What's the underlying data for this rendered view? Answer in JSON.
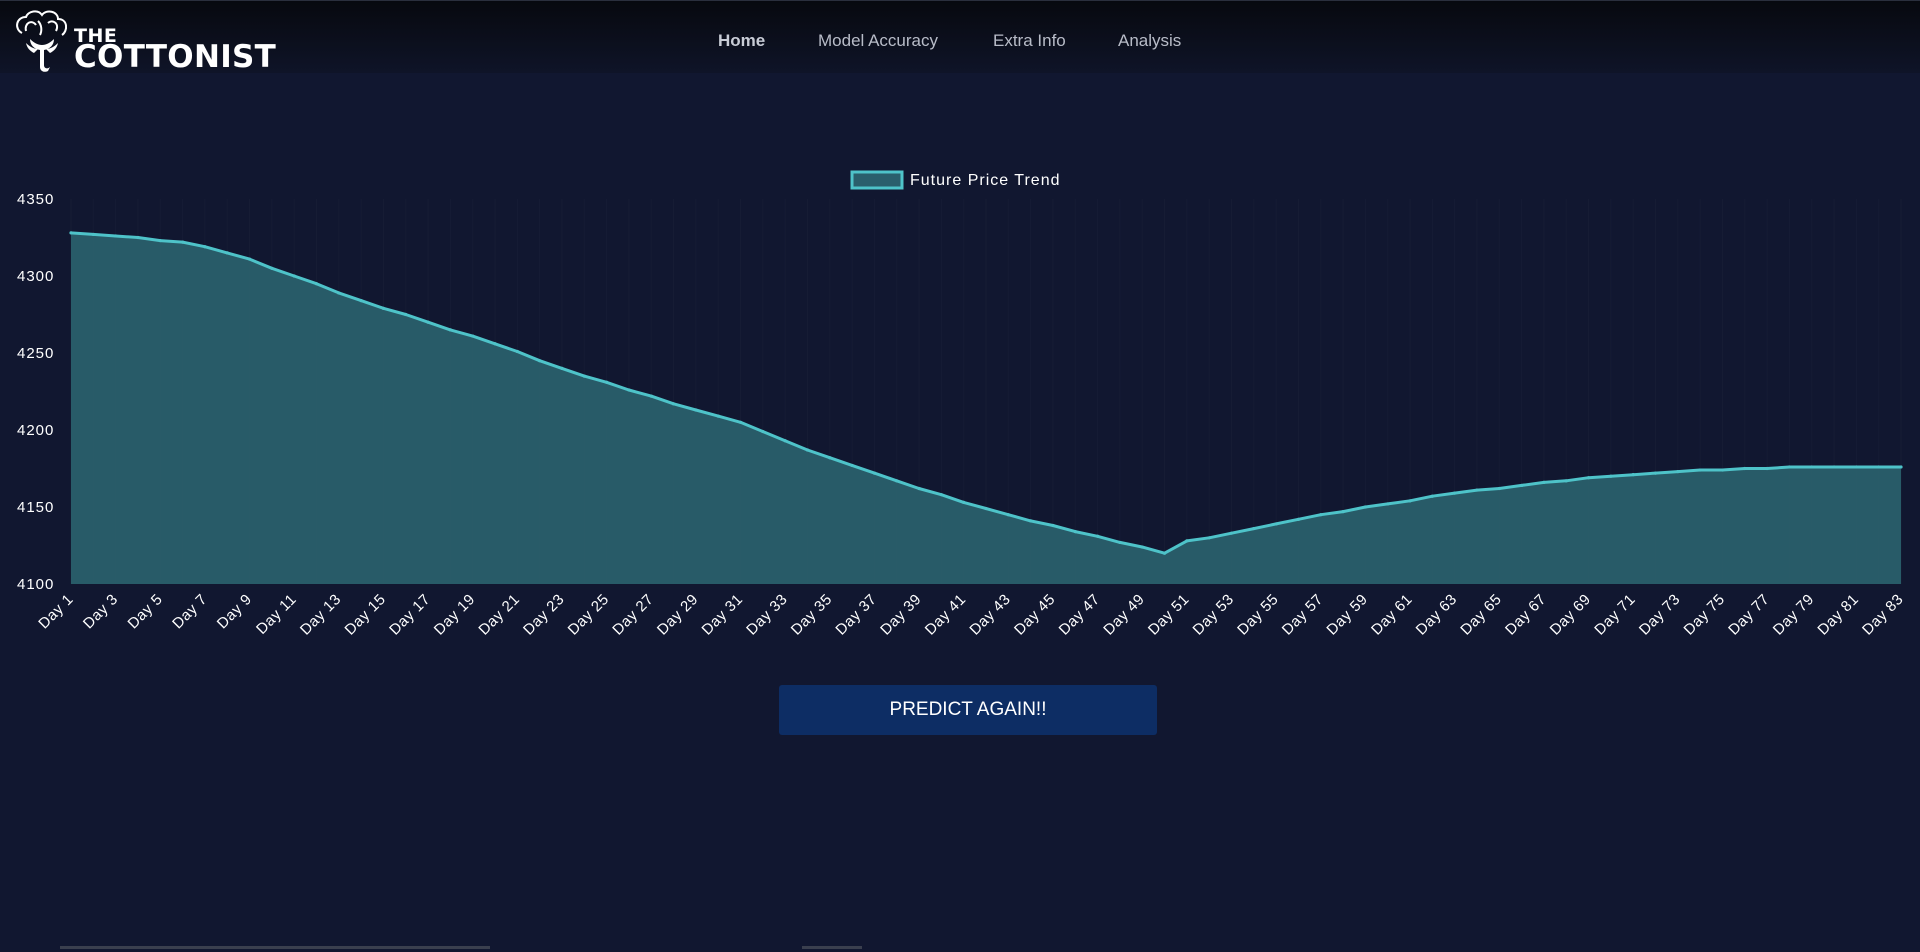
{
  "brand": {
    "line1": "THE",
    "line2": "COTTONIST",
    "icon": "cotton-plant-icon"
  },
  "nav": {
    "items": [
      {
        "label": "Home",
        "active": true
      },
      {
        "label": "Model Accuracy",
        "active": false
      },
      {
        "label": "Extra Info",
        "active": false
      },
      {
        "label": "Analysis",
        "active": false
      }
    ]
  },
  "actions": {
    "predict_label": "PREDICT AGAIN!!"
  },
  "colors": {
    "background": "#111730",
    "line": "#4ec3c9",
    "fill": "#2a5f6c",
    "button": "#0d2d64"
  },
  "chart_data": {
    "type": "area",
    "legend": "Future Price Trend",
    "legend_position": "top-center",
    "grid": false,
    "ylim": [
      4100,
      4350
    ],
    "yticks": [
      4100,
      4150,
      4200,
      4250,
      4300,
      4350
    ],
    "x": [
      "Day 1",
      "Day 2",
      "Day 3",
      "Day 4",
      "Day 5",
      "Day 6",
      "Day 7",
      "Day 8",
      "Day 9",
      "Day 10",
      "Day 11",
      "Day 12",
      "Day 13",
      "Day 14",
      "Day 15",
      "Day 16",
      "Day 17",
      "Day 18",
      "Day 19",
      "Day 20",
      "Day 21",
      "Day 22",
      "Day 23",
      "Day 24",
      "Day 25",
      "Day 26",
      "Day 27",
      "Day 28",
      "Day 29",
      "Day 30",
      "Day 31",
      "Day 32",
      "Day 33",
      "Day 34",
      "Day 35",
      "Day 36",
      "Day 37",
      "Day 38",
      "Day 39",
      "Day 40",
      "Day 41",
      "Day 42",
      "Day 43",
      "Day 44",
      "Day 45",
      "Day 46",
      "Day 47",
      "Day 48",
      "Day 49",
      "Day 50",
      "Day 51",
      "Day 52",
      "Day 53",
      "Day 54",
      "Day 55",
      "Day 56",
      "Day 57",
      "Day 58",
      "Day 59",
      "Day 60",
      "Day 61",
      "Day 62",
      "Day 63",
      "Day 64",
      "Day 65",
      "Day 66",
      "Day 67",
      "Day 68",
      "Day 69",
      "Day 70",
      "Day 71",
      "Day 72",
      "Day 73",
      "Day 74",
      "Day 75",
      "Day 76",
      "Day 77",
      "Day 78",
      "Day 79",
      "Day 80",
      "Day 81",
      "Day 82",
      "Day 83"
    ],
    "values": [
      4328,
      4327,
      4326,
      4325,
      4323,
      4322,
      4319,
      4315,
      4311,
      4305,
      4300,
      4295,
      4289,
      4284,
      4279,
      4275,
      4270,
      4265,
      4261,
      4256,
      4251,
      4245,
      4240,
      4235,
      4231,
      4226,
      4222,
      4217,
      4213,
      4209,
      4205,
      4199,
      4193,
      4187,
      4182,
      4177,
      4172,
      4167,
      4162,
      4158,
      4153,
      4149,
      4145,
      4141,
      4138,
      4134,
      4131,
      4127,
      4124,
      4120,
      4128,
      4130,
      4133,
      4136,
      4139,
      4142,
      4145,
      4147,
      4150,
      4152,
      4154,
      4157,
      4159,
      4161,
      4162,
      4164,
      4166,
      4167,
      4169,
      4170,
      4171,
      4172,
      4173,
      4174,
      4174,
      4175,
      4175,
      4176,
      4176,
      4176,
      4176,
      4176,
      4176
    ]
  }
}
